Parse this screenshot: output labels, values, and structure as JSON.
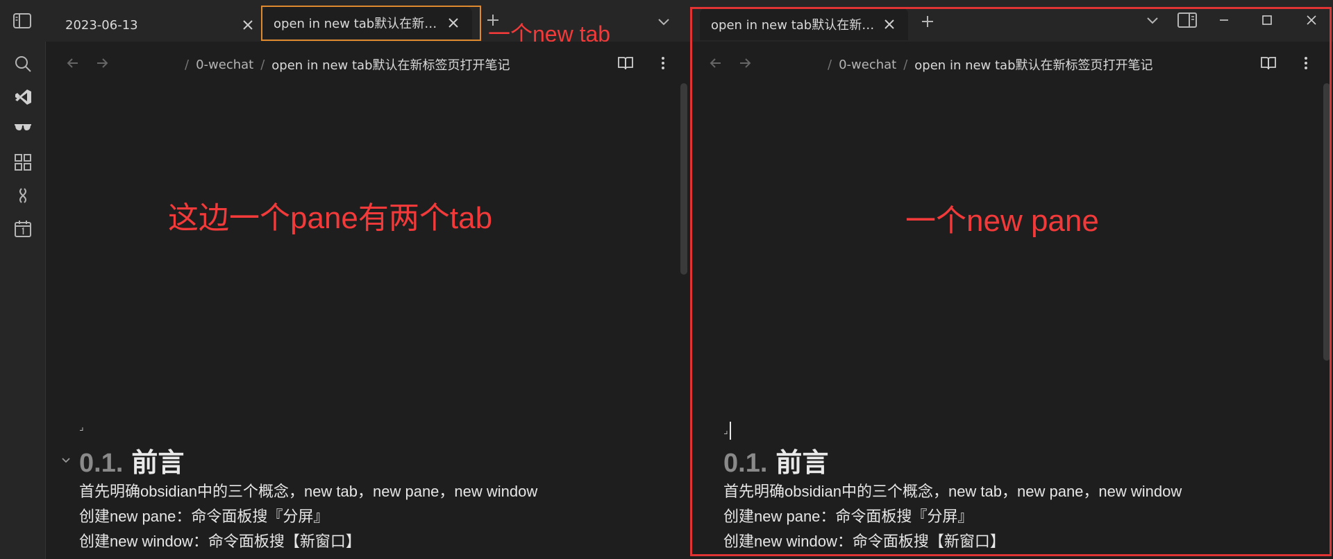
{
  "left_tabbar": {
    "tabs": [
      {
        "title": "2023-06-13"
      },
      {
        "title": "open in new tab默认在新标签页打开笔记"
      }
    ]
  },
  "right_tabbar": {
    "tabs": [
      {
        "title": "open in new tab默认在新标签页打开笔记"
      }
    ]
  },
  "left_pane": {
    "breadcrumb": [
      "0-wechat",
      "open in new tab默认在新标签页打开笔记"
    ],
    "marker": "⌟",
    "heading_number": "0.1.",
    "heading_text": "前言",
    "paragraphs": [
      "首先明确obsidian中的三个概念，new tab，new pane，new window",
      "创建new pane：命令面板搜『分屏』",
      "创建new window：命令面板搜【新窗口】"
    ]
  },
  "right_pane": {
    "breadcrumb": [
      "0-wechat",
      "open in new tab默认在新标签页打开笔记"
    ],
    "marker": "⌟",
    "heading_number": "0.1.",
    "heading_text": "前言",
    "paragraphs": [
      "首先明确obsidian中的三个概念，new tab，new pane，new window",
      "创建new pane：命令面板搜『分屏』",
      "创建new window：命令面板搜【新窗口】"
    ]
  },
  "annotations": {
    "new_tab": "一个new tab",
    "left_pane": "这边一个pane有两个tab",
    "new_pane": "一个new pane"
  },
  "colors": {
    "annotation_red": "#f23a3a",
    "highlight_orange": "#e08a2f",
    "background": "#1e1e1e",
    "tabbar": "#262626"
  },
  "icons": [
    "sidebar-toggle-icon",
    "close-icon",
    "plus-icon",
    "chevron-down-icon",
    "search-icon",
    "vscode-icon",
    "glasses-icon",
    "blocks-icon",
    "link-icon",
    "calendar-icon",
    "arrow-left-icon",
    "arrow-right-icon",
    "reading-view-icon",
    "more-options-icon",
    "split-view-icon",
    "minimize-icon",
    "maximize-icon"
  ]
}
